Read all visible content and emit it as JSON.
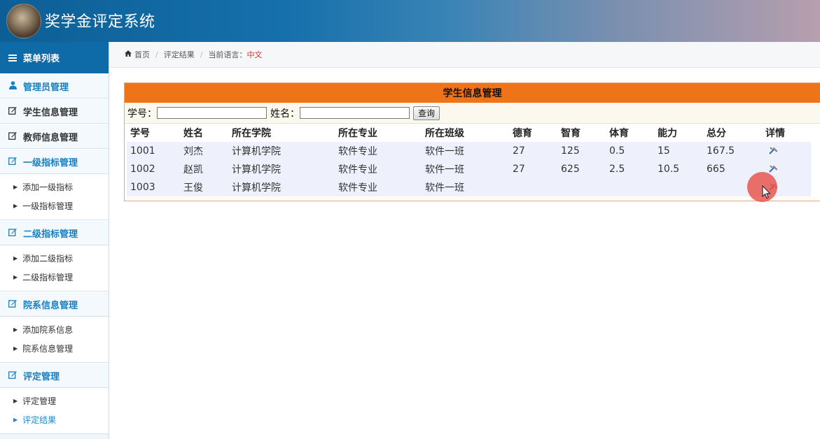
{
  "app": {
    "title": "奖学金评定系统"
  },
  "sidebar": {
    "header": "菜单列表",
    "sections": [
      {
        "label": "管理员管理",
        "icon": "user-icon",
        "items": []
      },
      {
        "label": "学生信息管理",
        "icon": "edit-icon",
        "items": []
      },
      {
        "label": "教师信息管理",
        "icon": "edit-icon",
        "items": []
      },
      {
        "label": "一级指标管理",
        "icon": "edit-icon",
        "items": [
          "添加一级指标",
          "一级指标管理"
        ]
      },
      {
        "label": "二级指标管理",
        "icon": "edit-icon",
        "items": [
          "添加二级指标",
          "二级指标管理"
        ]
      },
      {
        "label": "院系信息管理",
        "icon": "edit-icon",
        "items": [
          "添加院系信息",
          "院系信息管理"
        ]
      },
      {
        "label": "评定管理",
        "icon": "edit-icon",
        "items": [
          "评定管理",
          "评定结果"
        ]
      }
    ]
  },
  "breadcrumb": {
    "home": "首页",
    "current": "评定结果",
    "lang_label": "当前语言：",
    "lang_value": "中文"
  },
  "panel": {
    "title": "学生信息管理",
    "search": {
      "id_label": "学号：",
      "name_label": "姓名：",
      "id_value": "",
      "name_value": "",
      "button": "查询"
    },
    "columns": [
      "学号",
      "姓名",
      "所在学院",
      "所在专业",
      "所在班级",
      "德育",
      "智育",
      "体育",
      "能力",
      "总分",
      "详情"
    ],
    "rows": [
      [
        "1001",
        "刘杰",
        "计算机学院",
        "软件专业",
        "软件一班",
        "27",
        "125",
        "0.5",
        "15",
        "167.5"
      ],
      [
        "1002",
        "赵凯",
        "计算机学院",
        "软件专业",
        "软件一班",
        "27",
        "625",
        "2.5",
        "10.5",
        "665"
      ],
      [
        "1003",
        "王俊",
        "计算机学院",
        "软件专业",
        "软件一班",
        "",
        "",
        "",
        "",
        ""
      ]
    ]
  },
  "colors": {
    "header_start": "#0c5f96",
    "sidebar_accent": "#1a7fc0",
    "panel_title_bg": "#ef7318",
    "lang_value": "#d9332b",
    "row_bg": "#eef0fb"
  }
}
